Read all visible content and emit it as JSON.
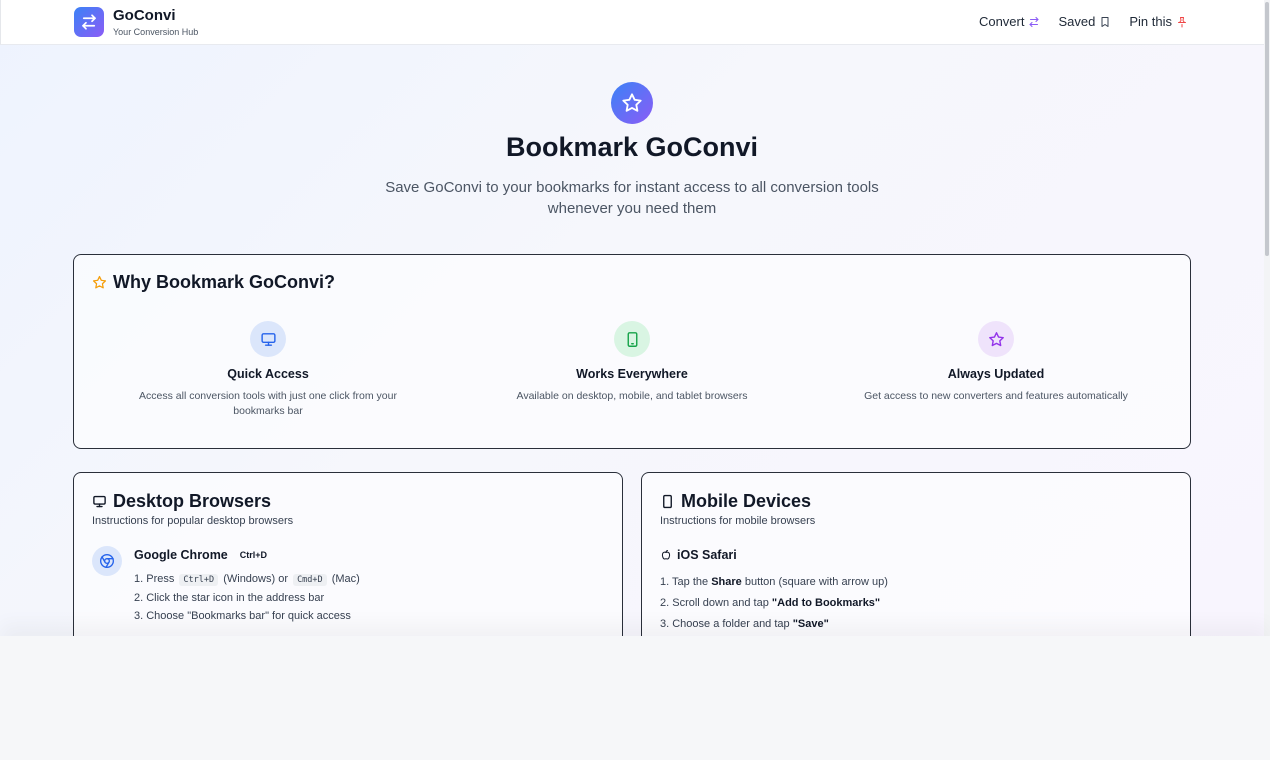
{
  "header": {
    "brand_name": "GoConvi",
    "brand_tagline": "Your Conversion Hub",
    "nav": [
      {
        "label": "Convert",
        "icon": "arrows-swap-icon",
        "color": "#8b5cf6"
      },
      {
        "label": "Saved",
        "icon": "bookmark-icon",
        "color": "#374151"
      },
      {
        "label": "Pin this",
        "icon": "pin-icon",
        "color": "#ef4444"
      }
    ]
  },
  "hero": {
    "icon": "star-icon",
    "title": "Bookmark GoConvi",
    "subtitle": "Save GoConvi to your bookmarks for instant access to all conversion tools whenever you need them"
  },
  "why": {
    "title": "Why Bookmark GoConvi?",
    "icon_color": "#f59e0b",
    "features": [
      {
        "icon": "monitor-icon",
        "title": "Quick Access",
        "desc": "Access all conversion tools with just one click from your bookmarks bar",
        "bg": "#dbe6fb",
        "fg": "#2563eb"
      },
      {
        "icon": "tablet-icon",
        "title": "Works Everywhere",
        "desc": "Available on desktop, mobile, and tablet browsers",
        "bg": "#d9f5e3",
        "fg": "#16a34a"
      },
      {
        "icon": "star-icon",
        "title": "Always Updated",
        "desc": "Get access to new converters and features automatically",
        "bg": "#efe3fb",
        "fg": "#9333ea"
      }
    ]
  },
  "desktop": {
    "title": "Desktop Browsers",
    "subtitle": "Instructions for popular desktop browsers",
    "browser": {
      "name": "Google Chrome",
      "shortcut": "Ctrl+D",
      "step1_prefix": "1. Press",
      "step1_key1": "Ctrl+D",
      "step1_mid": "(Windows) or",
      "step1_key2": "Cmd+D",
      "step1_suffix": "(Mac)",
      "step2": "2. Click the star icon in the address bar",
      "step3": "3. Choose \"Bookmarks bar\" for quick access"
    }
  },
  "mobile": {
    "title": "Mobile Devices",
    "subtitle": "Instructions for mobile browsers",
    "platform": {
      "name": "iOS Safari",
      "step1_prefix": "1. Tap the",
      "step1_bold": "Share",
      "step1_suffix": "button (square with arrow up)",
      "step2_prefix": "2. Scroll down and tap",
      "step2_bold": "\"Add to Bookmarks\"",
      "step3_prefix": "3. Choose a folder and tap",
      "step3_bold": "\"Save\""
    }
  }
}
